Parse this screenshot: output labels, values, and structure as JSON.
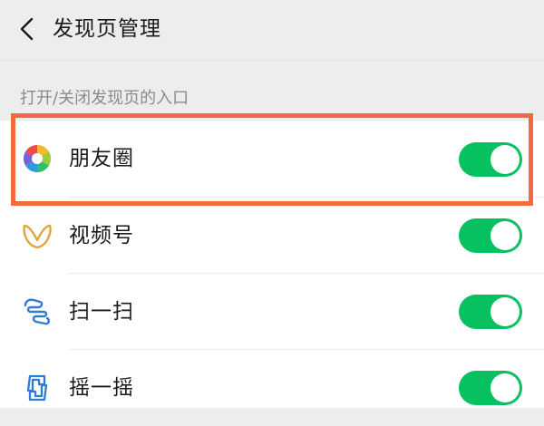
{
  "header": {
    "title": "发现页管理",
    "back_icon": "chevron-left-icon"
  },
  "section": {
    "label": "打开/关闭发现页的入口"
  },
  "items": [
    {
      "label": "朋友圈",
      "icon": "moments-aperture-icon",
      "enabled": true,
      "highlighted": true
    },
    {
      "label": "视频号",
      "icon": "channels-butterfly-icon",
      "enabled": true,
      "highlighted": false
    },
    {
      "label": "扫一扫",
      "icon": "scan-icon",
      "enabled": true,
      "highlighted": false
    },
    {
      "label": "摇一摇",
      "icon": "shake-icon",
      "enabled": true,
      "highlighted": false
    }
  ],
  "colors": {
    "toggle_on": "#07c160",
    "highlight_border": "#f26a3d",
    "page_bg": "#ededed",
    "icon_blue": "#2f7bd6",
    "icon_gold": "#e3a53a"
  }
}
